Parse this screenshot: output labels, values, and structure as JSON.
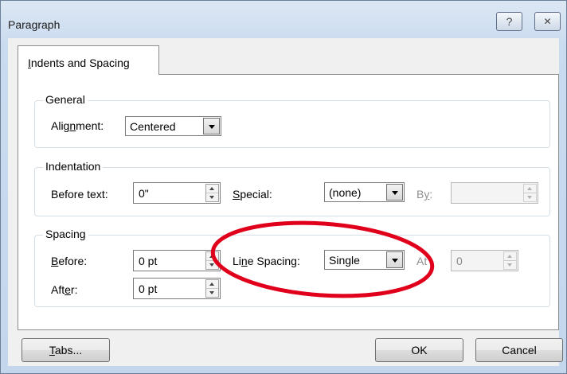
{
  "window": {
    "title": "Paragraph",
    "help_glyph": "?",
    "close_glyph": "✕"
  },
  "tabs": [
    {
      "pre": "I",
      "rest": "ndents and Spacing",
      "selected": true
    }
  ],
  "general": {
    "legend": "General",
    "alignment_label": {
      "pre": "Alig",
      "key": "n",
      "post": "ment:"
    },
    "alignment_value": "Centered"
  },
  "indentation": {
    "legend": "Indentation",
    "before_text_label": "Before text:",
    "before_text_value": "0\"",
    "special_label": {
      "key": "S",
      "post": "pecial:"
    },
    "special_value": "(none)",
    "by_label": {
      "pre": "B",
      "key": "y",
      "post": ":"
    },
    "by_value": ""
  },
  "spacing": {
    "legend": "Spacing",
    "before_label": {
      "key": "B",
      "post": "efore:"
    },
    "before_value": "0 pt",
    "after_label": {
      "pre": "Aft",
      "key": "e",
      "post": "r:"
    },
    "after_value": "0 pt",
    "line_spacing_label": {
      "pre": "Li",
      "key": "n",
      "post": "e Spacing:"
    },
    "line_spacing_value": "Single",
    "at_label": "At",
    "at_value": "0"
  },
  "buttons": {
    "tabs": {
      "key": "T",
      "post": "abs..."
    },
    "ok": "OK",
    "cancel": "Cancel"
  },
  "colors": {
    "highlight_circle": "#e0001b",
    "title_bar": "#c9dbef"
  },
  "icons": {
    "help": "help-icon",
    "close": "close-icon",
    "dropdown": "chevron-down-icon",
    "spin": "spin-arrows-icon"
  }
}
